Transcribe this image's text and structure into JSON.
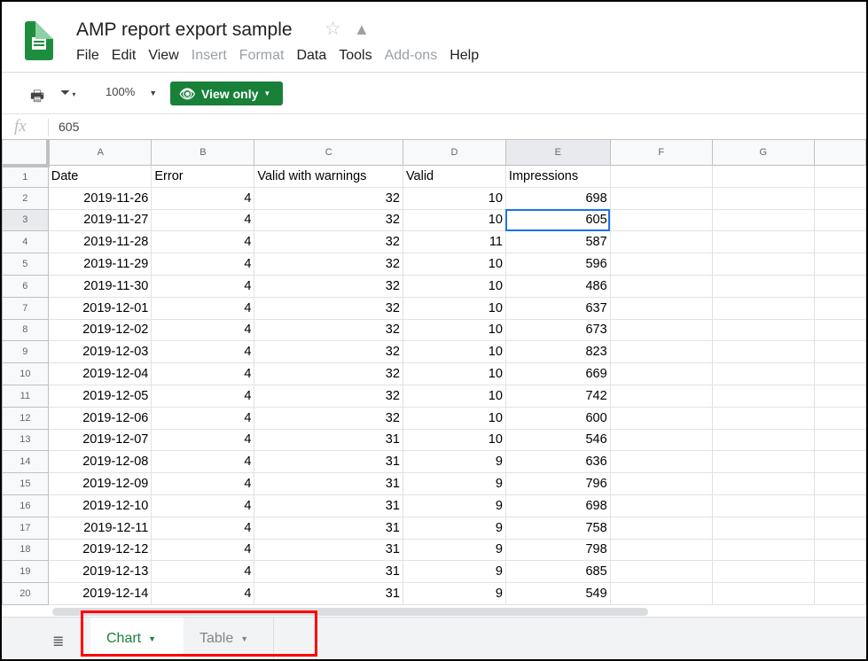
{
  "app": {
    "title": "AMP report export sample"
  },
  "menu": [
    {
      "label": "File",
      "enabled": true
    },
    {
      "label": "Edit",
      "enabled": true
    },
    {
      "label": "View",
      "enabled": true
    },
    {
      "label": "Insert",
      "enabled": false
    },
    {
      "label": "Format",
      "enabled": false
    },
    {
      "label": "Data",
      "enabled": true
    },
    {
      "label": "Tools",
      "enabled": true
    },
    {
      "label": "Add-ons",
      "enabled": false
    },
    {
      "label": "Help",
      "enabled": true
    }
  ],
  "toolbar": {
    "zoom": "100%",
    "view_only": "View only",
    "accent": "#188038"
  },
  "formula": {
    "fx": "fx",
    "value": "605"
  },
  "columns": [
    "A",
    "B",
    "C",
    "D",
    "E",
    "F",
    "G"
  ],
  "headers": [
    "Date",
    "Error",
    "Valid with warnings",
    "Valid",
    "Impressions"
  ],
  "rows": [
    [
      "2019-11-26",
      "4",
      "32",
      "10",
      "698"
    ],
    [
      "2019-11-27",
      "4",
      "32",
      "10",
      "605"
    ],
    [
      "2019-11-28",
      "4",
      "32",
      "11",
      "587"
    ],
    [
      "2019-11-29",
      "4",
      "32",
      "10",
      "596"
    ],
    [
      "2019-11-30",
      "4",
      "32",
      "10",
      "486"
    ],
    [
      "2019-12-01",
      "4",
      "32",
      "10",
      "637"
    ],
    [
      "2019-12-02",
      "4",
      "32",
      "10",
      "673"
    ],
    [
      "2019-12-03",
      "4",
      "32",
      "10",
      "823"
    ],
    [
      "2019-12-04",
      "4",
      "32",
      "10",
      "669"
    ],
    [
      "2019-12-05",
      "4",
      "32",
      "10",
      "742"
    ],
    [
      "2019-12-06",
      "4",
      "32",
      "10",
      "600"
    ],
    [
      "2019-12-07",
      "4",
      "31",
      "10",
      "546"
    ],
    [
      "2019-12-08",
      "4",
      "31",
      "9",
      "636"
    ],
    [
      "2019-12-09",
      "4",
      "31",
      "9",
      "796"
    ],
    [
      "2019-12-10",
      "4",
      "31",
      "9",
      "698"
    ],
    [
      "2019-12-11",
      "4",
      "31",
      "9",
      "758"
    ],
    [
      "2019-12-12",
      "4",
      "31",
      "9",
      "798"
    ],
    [
      "2019-12-13",
      "4",
      "31",
      "9",
      "685"
    ],
    [
      "2019-12-14",
      "4",
      "31",
      "9",
      "549"
    ]
  ],
  "selected": {
    "row": 3,
    "col": "E"
  },
  "sheet_tabs": [
    {
      "label": "Chart",
      "active": true
    },
    {
      "label": "Table",
      "active": false
    }
  ]
}
